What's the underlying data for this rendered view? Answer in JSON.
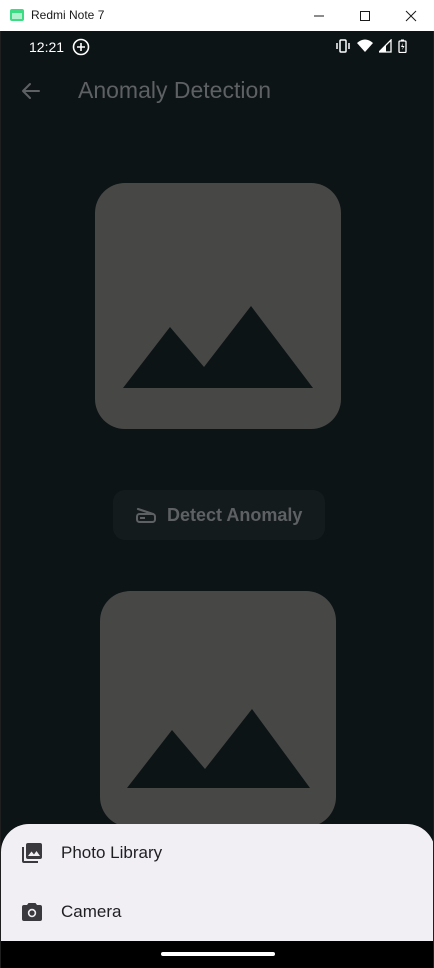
{
  "window": {
    "title": "Redmi Note 7",
    "app_icon_color": "#3ddc84"
  },
  "status_bar": {
    "time": "12:21",
    "icons": [
      "add-circle-icon",
      "vibrate-icon",
      "wifi-icon",
      "signal-icon",
      "battery-charging-icon"
    ]
  },
  "app_bar": {
    "title": "Anomaly Detection",
    "back_icon": "arrow-back-icon"
  },
  "main": {
    "detect_button_label": "Detect Anomaly",
    "detect_button_icon": "scanner-icon",
    "placeholder_icon": "image-icon"
  },
  "bottom_sheet": {
    "items": [
      {
        "label": "Photo Library",
        "icon": "photo-library-icon"
      },
      {
        "label": "Camera",
        "icon": "camera-icon"
      }
    ]
  },
  "colors": {
    "background": "#0c1416",
    "placeholder": "#474745",
    "muted_text": "#5e6163",
    "sheet_bg": "#f2eff4"
  }
}
